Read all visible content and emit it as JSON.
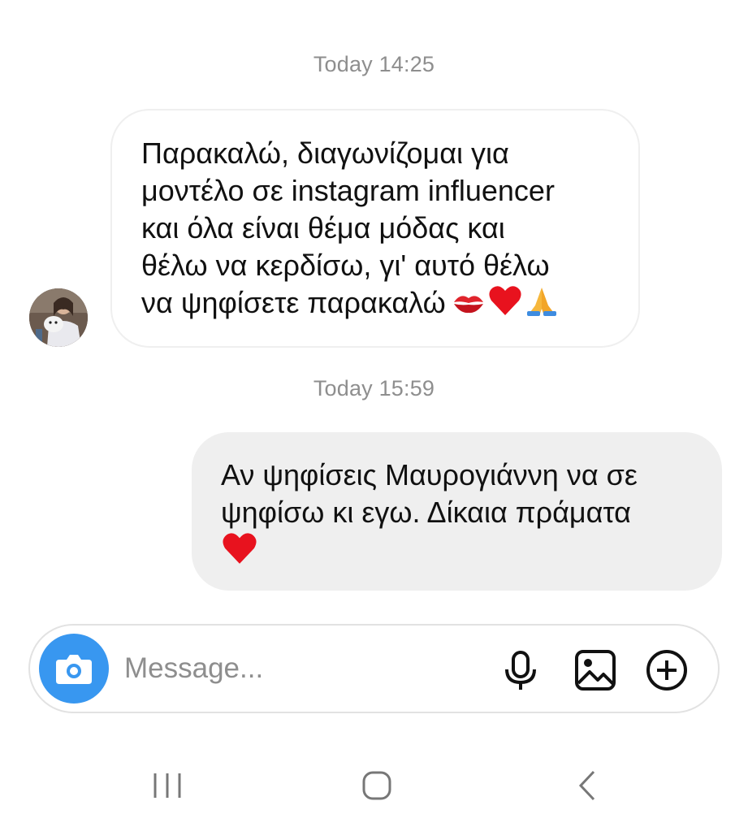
{
  "thread": {
    "timestamp_1": "Today 14:25",
    "timestamp_2": "Today 15:59",
    "incoming_message": {
      "lines": [
        "Παρακαλώ, διαγωνίζομαι για",
        "μοντέλο σε instagram influencer",
        "και όλα είναι θέμα μόδας και",
        "θέλω να κερδίσω, γι' αυτό θέλω",
        "να ψηφίσετε παρακαλώ"
      ],
      "emojis": [
        "kiss-mark",
        "red-heart",
        "folded-hands"
      ]
    },
    "outgoing_message": {
      "lines": [
        "Αν ψηφίσεις Μαυρογιάννη να σε",
        "ψηφίσω κι εγω. Δίκαια πράματα"
      ],
      "emojis": [
        "red-heart"
      ]
    }
  },
  "composer": {
    "placeholder": "Message...",
    "icons": [
      "camera-icon",
      "microphone-icon",
      "gallery-icon",
      "add-circle-icon"
    ],
    "accent_color": "#3897f0"
  },
  "navigation_bar": {
    "icons": [
      "recent-apps-icon",
      "home-icon",
      "back-icon"
    ]
  }
}
